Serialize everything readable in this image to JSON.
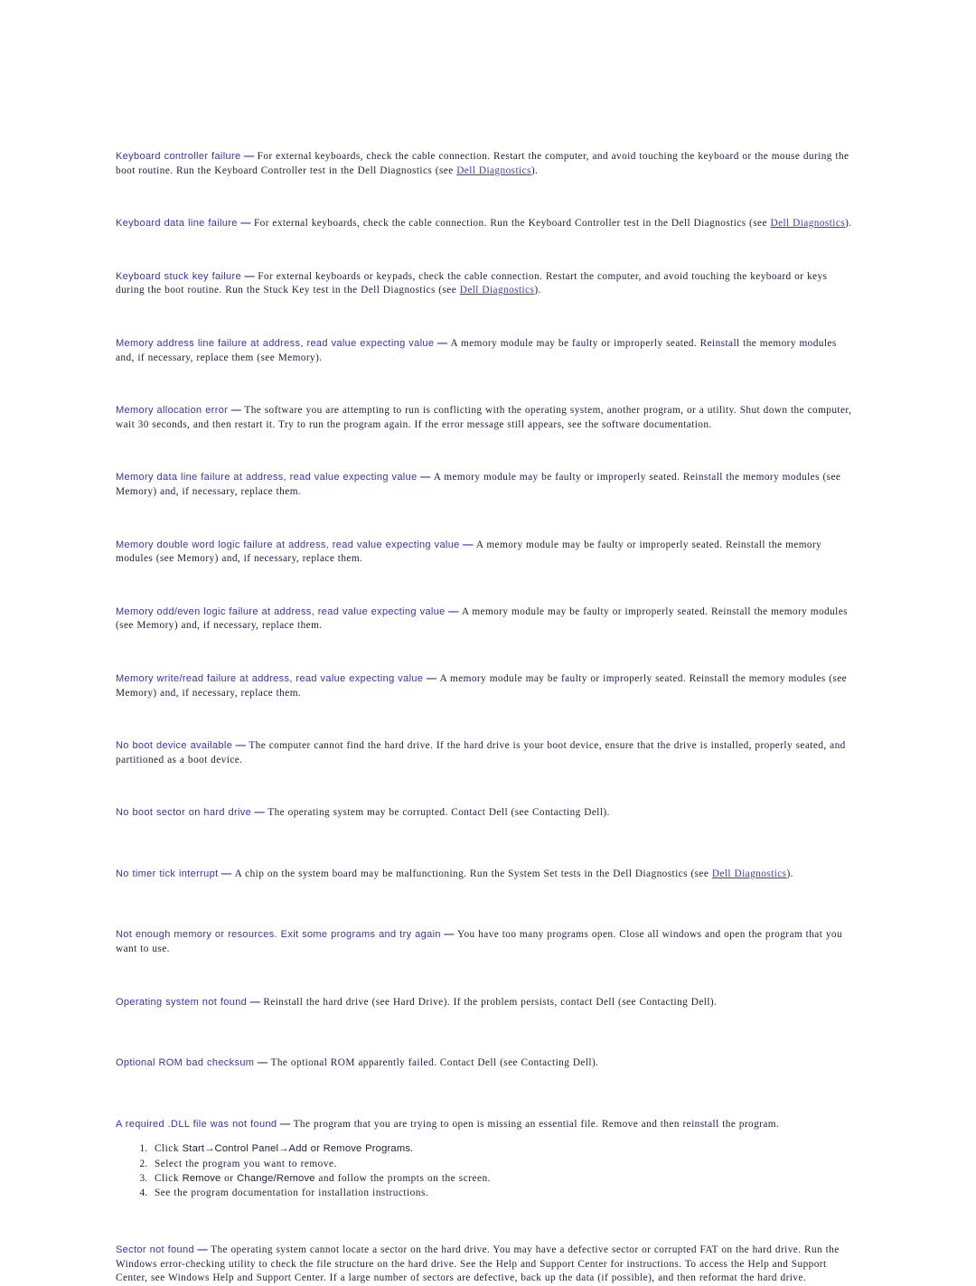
{
  "document": {
    "kind": "error-messages-reference",
    "link_label": "Dell Diagnostics",
    "separator": "—",
    "arrow": "→",
    "colors": {
      "heading": "#3434a8",
      "body": "#1c1c3a",
      "link": "#3a3ab4",
      "page_background": "#ffffff"
    }
  },
  "entries": [
    {
      "id": "keyboard-controller-failure",
      "heading": "Keyboard controller failure",
      "body_before_link": "For external keyboards, check the cable connection. Restart the computer, and avoid touching the keyboard or the mouse during the boot routine. Run the Keyboard Controller test in the Dell Diagnostics (see ",
      "link": "Dell Diagnostics",
      "body_after_link": ")."
    },
    {
      "id": "keyboard-data-line-failure",
      "heading": "Keyboard data line failure",
      "body_before_link": "For external keyboards, check the cable connection. Run the Keyboard Controller test in the Dell Diagnostics (see ",
      "link": "Dell Diagnostics",
      "body_after_link": ")."
    },
    {
      "id": "keyboard-stuck-key-failure",
      "heading": "Keyboard stuck key failure",
      "body_before_link": "For external keyboards or keypads, check the cable connection. Restart the computer, and avoid touching the keyboard or keys during the boot routine. Run the Stuck Key test in the Dell Diagnostics (see ",
      "link": "Dell Diagnostics",
      "body_after_link": ")."
    },
    {
      "id": "memory-address-line-failure",
      "heading": "Memory address line failure at address, read value expecting value",
      "body": "A memory module may be faulty or improperly seated. Reinstall the memory modules and, if necessary, replace them (see Memory)."
    },
    {
      "id": "memory-allocation-error",
      "heading": "Memory allocation error",
      "body": "The software you are attempting to run is conflicting with the operating system, another program, or a utility. Shut down the computer, wait 30 seconds, and then restart it. Try to run the program again. If the error message still appears, see the software documentation."
    },
    {
      "id": "memory-data-line-failure",
      "heading": "Memory data line failure at address, read value expecting value",
      "body": "A memory module may be faulty or improperly seated. Reinstall the memory modules (see Memory) and, if necessary, replace them."
    },
    {
      "id": "memory-double-word-logic-failure",
      "heading": "Memory double word logic failure at address, read value expecting value",
      "body": "A memory module may be faulty or improperly seated. Reinstall the memory modules (see Memory) and, if necessary, replace them."
    },
    {
      "id": "memory-odd-even-logic-failure",
      "heading": "Memory odd/even logic failure at address, read value expecting value",
      "body": "A memory module may be faulty or improperly seated. Reinstall the memory modules (see Memory) and, if necessary, replace them."
    },
    {
      "id": "memory-write-read-failure",
      "heading": "Memory write/read failure at address, read value expecting value",
      "body": "A memory module may be faulty or improperly seated. Reinstall the memory modules (see Memory) and, if necessary, replace them."
    },
    {
      "id": "no-boot-device-available",
      "heading": "No boot device available",
      "body": "The computer cannot find the hard drive. If the hard drive is your boot device, ensure that the drive is installed, properly seated, and partitioned as a boot device."
    },
    {
      "id": "no-boot-sector-on-hard-drive",
      "heading": "No boot sector on hard drive",
      "body": "The operating system may be corrupted. Contact Dell (see Contacting Dell)."
    },
    {
      "id": "no-timer-tick-interrupt",
      "heading": "No timer tick interrupt",
      "body_before_link": "A chip on the system board may be malfunctioning. Run the System Set tests in the Dell Diagnostics (see ",
      "link": "Dell Diagnostics",
      "body_after_link": ")."
    },
    {
      "id": "not-enough-memory-or-resources",
      "heading": "Not enough memory or resources. Exit some programs and try again",
      "body": "You have too many programs open. Close all windows and open the program that you want to use."
    },
    {
      "id": "operating-system-not-found",
      "heading": "Operating system not found",
      "body": "Reinstall the hard drive (see Hard Drive). If the problem persists, contact Dell (see Contacting Dell)."
    },
    {
      "id": "optional-rom-bad-checksum",
      "heading": "Optional ROM bad checksum",
      "body": "The optional ROM apparently failed. Contact Dell (see Contacting Dell)."
    }
  ],
  "dll_entry": {
    "id": "required-dll-file-not-found",
    "heading": "A required .DLL file was not found",
    "body": "The program that you are trying to open is missing an essential file. Remove and then reinstall the program.",
    "steps": [
      {
        "num": "1.",
        "pre": "Click ",
        "ui1": "Start",
        "arrow1": "→",
        "ui2": "Control Panel",
        "arrow2": "→",
        "ui3": "Add or Remove Programs",
        "post": "."
      },
      {
        "num": "2.",
        "text": "Select the program you want to remove."
      },
      {
        "num": "3.",
        "pre": "Click ",
        "ui1": "Remove",
        "mid": " or ",
        "ui2": "Change/Remove",
        "post": " and follow the prompts on the screen."
      },
      {
        "num": "4.",
        "text": "See the program documentation for installation instructions."
      }
    ]
  },
  "sector_entry": {
    "id": "sector-not-found",
    "heading": "Sector not found",
    "body": "The operating system cannot locate a sector on the hard drive. You may have a defective sector or corrupted FAT on the hard drive. Run the Windows error-checking utility to check the file structure on the hard drive. See the Help and Support Center for instructions. To access the Help and Support Center, see Windows Help and Support Center. If a large number of sectors are defective, back up the data (if possible), and then reformat the hard drive."
  }
}
